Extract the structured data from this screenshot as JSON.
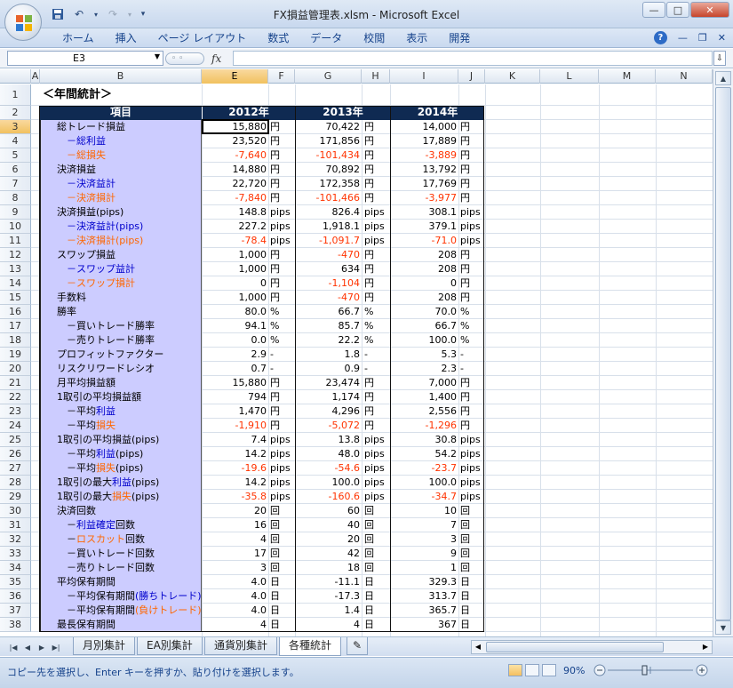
{
  "window": {
    "title": "FX損益管理表.xlsm - Microsoft Excel"
  },
  "ribbon": {
    "tabs": [
      "ホーム",
      "挿入",
      "ページ レイアウト",
      "数式",
      "データ",
      "校閲",
      "表示",
      "開発"
    ],
    "help_label": "?"
  },
  "formula_bar": {
    "name_box": "E3",
    "fx_label": "fx",
    "formula": ""
  },
  "columns": [
    "A",
    "B",
    "E",
    "F",
    "G",
    "H",
    "I",
    "J",
    "K",
    "L",
    "M",
    "N"
  ],
  "sheet": {
    "title": "＜年間統計＞",
    "header": {
      "label": "項目",
      "years": [
        "2012年",
        "2013年",
        "2014年"
      ]
    },
    "rows": [
      {
        "n": "3",
        "label": [
          {
            "t": "総トレード損益",
            "c": ""
          }
        ],
        "v": [
          [
            "15,880",
            "円",
            ""
          ],
          [
            "70,422",
            "円",
            ""
          ],
          [
            "14,000",
            "円",
            ""
          ]
        ]
      },
      {
        "n": "4",
        "label": [
          {
            "t": "　－総利益",
            "c": "blue"
          }
        ],
        "v": [
          [
            "23,520",
            "円",
            ""
          ],
          [
            "171,856",
            "円",
            ""
          ],
          [
            "17,889",
            "円",
            ""
          ]
        ]
      },
      {
        "n": "5",
        "label": [
          {
            "t": "　－総損失",
            "c": "red"
          }
        ],
        "v": [
          [
            "-7,640",
            "円",
            "neg"
          ],
          [
            "-101,434",
            "円",
            "neg"
          ],
          [
            "-3,889",
            "円",
            "neg"
          ]
        ]
      },
      {
        "n": "6",
        "label": [
          {
            "t": "決済損益",
            "c": ""
          }
        ],
        "v": [
          [
            "14,880",
            "円",
            ""
          ],
          [
            "70,892",
            "円",
            ""
          ],
          [
            "13,792",
            "円",
            ""
          ]
        ]
      },
      {
        "n": "7",
        "label": [
          {
            "t": "　－決済益計",
            "c": "blue"
          }
        ],
        "v": [
          [
            "22,720",
            "円",
            ""
          ],
          [
            "172,358",
            "円",
            ""
          ],
          [
            "17,769",
            "円",
            ""
          ]
        ]
      },
      {
        "n": "8",
        "label": [
          {
            "t": "　－決済損計",
            "c": "red"
          }
        ],
        "v": [
          [
            "-7,840",
            "円",
            "neg"
          ],
          [
            "-101,466",
            "円",
            "neg"
          ],
          [
            "-3,977",
            "円",
            "neg"
          ]
        ]
      },
      {
        "n": "9",
        "label": [
          {
            "t": "決済損益(pips)",
            "c": ""
          }
        ],
        "v": [
          [
            "148.8",
            "pips",
            ""
          ],
          [
            "826.4",
            "pips",
            ""
          ],
          [
            "308.1",
            "pips",
            ""
          ]
        ]
      },
      {
        "n": "10",
        "label": [
          {
            "t": "　－決済益計(pips)",
            "c": "blue"
          }
        ],
        "v": [
          [
            "227.2",
            "pips",
            ""
          ],
          [
            "1,918.1",
            "pips",
            ""
          ],
          [
            "379.1",
            "pips",
            ""
          ]
        ]
      },
      {
        "n": "11",
        "label": [
          {
            "t": "　－決済損計(pips)",
            "c": "red"
          }
        ],
        "v": [
          [
            "-78.4",
            "pips",
            "neg"
          ],
          [
            "-1,091.7",
            "pips",
            "neg"
          ],
          [
            "-71.0",
            "pips",
            "neg"
          ]
        ]
      },
      {
        "n": "12",
        "label": [
          {
            "t": "スワップ損益",
            "c": ""
          }
        ],
        "v": [
          [
            "1,000",
            "円",
            ""
          ],
          [
            "-470",
            "円",
            "neg"
          ],
          [
            "208",
            "円",
            ""
          ]
        ]
      },
      {
        "n": "13",
        "label": [
          {
            "t": "　－スワップ益計",
            "c": "blue"
          }
        ],
        "v": [
          [
            "1,000",
            "円",
            ""
          ],
          [
            "634",
            "円",
            ""
          ],
          [
            "208",
            "円",
            ""
          ]
        ]
      },
      {
        "n": "14",
        "label": [
          {
            "t": "　－スワップ損計",
            "c": "red"
          }
        ],
        "v": [
          [
            "0",
            "円",
            ""
          ],
          [
            "-1,104",
            "円",
            "neg"
          ],
          [
            "0",
            "円",
            ""
          ]
        ]
      },
      {
        "n": "15",
        "label": [
          {
            "t": "手数料",
            "c": ""
          }
        ],
        "v": [
          [
            "1,000",
            "円",
            ""
          ],
          [
            "-470",
            "円",
            "neg"
          ],
          [
            "208",
            "円",
            ""
          ]
        ]
      },
      {
        "n": "16",
        "label": [
          {
            "t": "勝率",
            "c": ""
          }
        ],
        "v": [
          [
            "80.0",
            "%",
            ""
          ],
          [
            "66.7",
            "%",
            ""
          ],
          [
            "70.0",
            "%",
            ""
          ]
        ]
      },
      {
        "n": "17",
        "label": [
          {
            "t": "　－買いトレード勝率",
            "c": ""
          }
        ],
        "v": [
          [
            "94.1",
            "%",
            ""
          ],
          [
            "85.7",
            "%",
            ""
          ],
          [
            "66.7",
            "%",
            ""
          ]
        ]
      },
      {
        "n": "18",
        "label": [
          {
            "t": "　－売りトレード勝率",
            "c": ""
          }
        ],
        "v": [
          [
            "0.0",
            "%",
            ""
          ],
          [
            "22.2",
            "%",
            ""
          ],
          [
            "100.0",
            "%",
            ""
          ]
        ]
      },
      {
        "n": "19",
        "label": [
          {
            "t": "プロフィットファクター",
            "c": ""
          }
        ],
        "v": [
          [
            "2.9",
            "-",
            ""
          ],
          [
            "1.8",
            "-",
            ""
          ],
          [
            "5.3",
            "-",
            ""
          ]
        ]
      },
      {
        "n": "20",
        "label": [
          {
            "t": "リスクリワードレシオ",
            "c": ""
          }
        ],
        "v": [
          [
            "0.7",
            "-",
            ""
          ],
          [
            "0.9",
            "-",
            ""
          ],
          [
            "2.3",
            "-",
            ""
          ]
        ]
      },
      {
        "n": "21",
        "label": [
          {
            "t": "月平均損益額",
            "c": ""
          }
        ],
        "v": [
          [
            "15,880",
            "円",
            ""
          ],
          [
            "23,474",
            "円",
            ""
          ],
          [
            "7,000",
            "円",
            ""
          ]
        ]
      },
      {
        "n": "22",
        "label": [
          {
            "t": "1取引の平均損益額",
            "c": ""
          }
        ],
        "v": [
          [
            "794",
            "円",
            ""
          ],
          [
            "1,174",
            "円",
            ""
          ],
          [
            "1,400",
            "円",
            ""
          ]
        ]
      },
      {
        "n": "23",
        "label": [
          {
            "t": "　－平均",
            "c": ""
          },
          {
            "t": "利益",
            "c": "blue"
          }
        ],
        "v": [
          [
            "1,470",
            "円",
            ""
          ],
          [
            "4,296",
            "円",
            ""
          ],
          [
            "2,556",
            "円",
            ""
          ]
        ]
      },
      {
        "n": "24",
        "label": [
          {
            "t": "　－平均",
            "c": ""
          },
          {
            "t": "損失",
            "c": "red"
          }
        ],
        "v": [
          [
            "-1,910",
            "円",
            "neg"
          ],
          [
            "-5,072",
            "円",
            "neg"
          ],
          [
            "-1,296",
            "円",
            "neg"
          ]
        ]
      },
      {
        "n": "25",
        "label": [
          {
            "t": "1取引の平均損益(pips)",
            "c": ""
          }
        ],
        "v": [
          [
            "7.4",
            "pips",
            ""
          ],
          [
            "13.8",
            "pips",
            ""
          ],
          [
            "30.8",
            "pips",
            ""
          ]
        ]
      },
      {
        "n": "26",
        "label": [
          {
            "t": "　－平均",
            "c": ""
          },
          {
            "t": "利益",
            "c": "blue"
          },
          {
            "t": "(pips)",
            "c": ""
          }
        ],
        "v": [
          [
            "14.2",
            "pips",
            ""
          ],
          [
            "48.0",
            "pips",
            ""
          ],
          [
            "54.2",
            "pips",
            ""
          ]
        ]
      },
      {
        "n": "27",
        "label": [
          {
            "t": "　－平均",
            "c": ""
          },
          {
            "t": "損失",
            "c": "red"
          },
          {
            "t": "(pips)",
            "c": ""
          }
        ],
        "v": [
          [
            "-19.6",
            "pips",
            "neg"
          ],
          [
            "-54.6",
            "pips",
            "neg"
          ],
          [
            "-23.7",
            "pips",
            "neg"
          ]
        ]
      },
      {
        "n": "28",
        "label": [
          {
            "t": "1取引の最大",
            "c": ""
          },
          {
            "t": "利益",
            "c": "blue"
          },
          {
            "t": "(pips)",
            "c": ""
          }
        ],
        "v": [
          [
            "14.2",
            "pips",
            ""
          ],
          [
            "100.0",
            "pips",
            ""
          ],
          [
            "100.0",
            "pips",
            ""
          ]
        ]
      },
      {
        "n": "29",
        "label": [
          {
            "t": "1取引の最大",
            "c": ""
          },
          {
            "t": "損失",
            "c": "red"
          },
          {
            "t": "(pips)",
            "c": ""
          }
        ],
        "v": [
          [
            "-35.8",
            "pips",
            "neg"
          ],
          [
            "-160.6",
            "pips",
            "neg"
          ],
          [
            "-34.7",
            "pips",
            "neg"
          ]
        ]
      },
      {
        "n": "30",
        "label": [
          {
            "t": "決済回数",
            "c": ""
          }
        ],
        "v": [
          [
            "20",
            "回",
            ""
          ],
          [
            "60",
            "回",
            ""
          ],
          [
            "10",
            "回",
            ""
          ]
        ]
      },
      {
        "n": "31",
        "label": [
          {
            "t": "　－",
            "c": ""
          },
          {
            "t": "利益確定",
            "c": "blue"
          },
          {
            "t": "回数",
            "c": ""
          }
        ],
        "v": [
          [
            "16",
            "回",
            ""
          ],
          [
            "40",
            "回",
            ""
          ],
          [
            "7",
            "回",
            ""
          ]
        ]
      },
      {
        "n": "32",
        "label": [
          {
            "t": "　－",
            "c": ""
          },
          {
            "t": "ロスカット",
            "c": "red"
          },
          {
            "t": "回数",
            "c": ""
          }
        ],
        "v": [
          [
            "4",
            "回",
            ""
          ],
          [
            "20",
            "回",
            ""
          ],
          [
            "3",
            "回",
            ""
          ]
        ]
      },
      {
        "n": "33",
        "label": [
          {
            "t": "　－買いトレード回数",
            "c": ""
          }
        ],
        "v": [
          [
            "17",
            "回",
            ""
          ],
          [
            "42",
            "回",
            ""
          ],
          [
            "9",
            "回",
            ""
          ]
        ]
      },
      {
        "n": "34",
        "label": [
          {
            "t": "　－売りトレード回数",
            "c": ""
          }
        ],
        "v": [
          [
            "3",
            "回",
            ""
          ],
          [
            "18",
            "回",
            ""
          ],
          [
            "1",
            "回",
            ""
          ]
        ]
      },
      {
        "n": "35",
        "label": [
          {
            "t": "平均保有期間",
            "c": ""
          }
        ],
        "v": [
          [
            "4.0",
            "日",
            ""
          ],
          [
            "-11.1",
            "日",
            ""
          ],
          [
            "329.3",
            "日",
            ""
          ]
        ]
      },
      {
        "n": "36",
        "label": [
          {
            "t": "　－平均保有期間",
            "c": ""
          },
          {
            "t": "(勝ちトレード)",
            "c": "blue"
          }
        ],
        "v": [
          [
            "4.0",
            "日",
            ""
          ],
          [
            "-17.3",
            "日",
            ""
          ],
          [
            "313.7",
            "日",
            ""
          ]
        ]
      },
      {
        "n": "37",
        "label": [
          {
            "t": "　－平均保有期間",
            "c": ""
          },
          {
            "t": "(負けトレード)",
            "c": "red"
          }
        ],
        "v": [
          [
            "4.0",
            "日",
            ""
          ],
          [
            "1.4",
            "日",
            ""
          ],
          [
            "365.7",
            "日",
            ""
          ]
        ]
      },
      {
        "n": "38",
        "label": [
          {
            "t": "最長保有期間",
            "c": ""
          }
        ],
        "v": [
          [
            "4",
            "日",
            ""
          ],
          [
            "4",
            "日",
            ""
          ],
          [
            "367",
            "日",
            ""
          ]
        ]
      }
    ]
  },
  "sheet_tabs": [
    "月別集計",
    "EA別集計",
    "通貨別集計",
    "各種統計"
  ],
  "active_tab": "各種統計",
  "status": {
    "message": "コピー先を選択し、Enter キーを押すか、貼り付けを選択します。",
    "zoom": "90%"
  }
}
